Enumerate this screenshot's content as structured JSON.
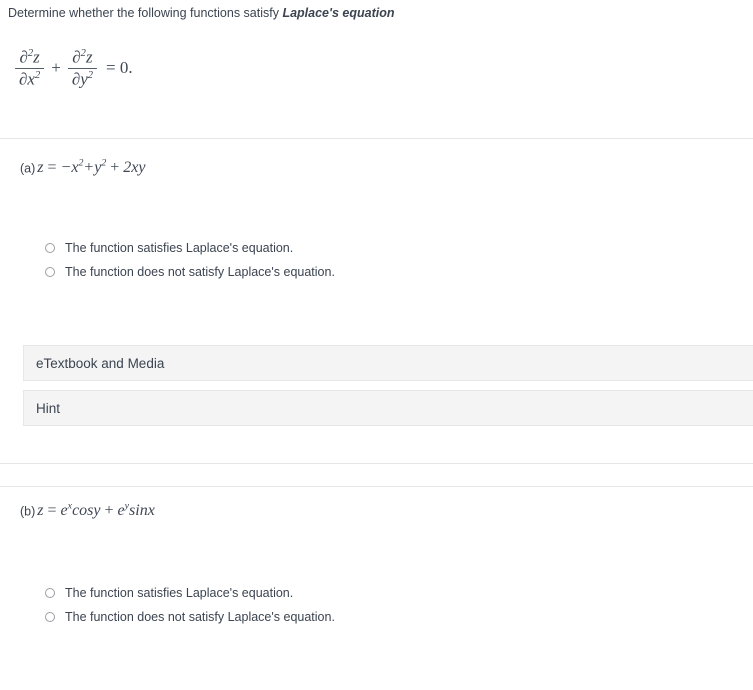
{
  "prompt": {
    "lead": "Determine whether the following functions satisfy ",
    "emphasis": "Laplace's equation"
  },
  "laplace_equation": {
    "numerator_1": "∂",
    "numerator_1_sup": "2",
    "numerator_1_var": "z",
    "denominator_1": "∂",
    "denominator_1_var": "x",
    "denominator_1_sup": "2",
    "operator": "+",
    "numerator_2": "∂",
    "numerator_2_sup": "2",
    "numerator_2_var": "z",
    "denominator_2": "∂",
    "denominator_2_var": "y",
    "denominator_2_sup": "2",
    "equals_zero": "= 0.",
    "plain_text": "∂²z/∂x² + ∂²z/∂y² = 0."
  },
  "parts": [
    {
      "tag": "(a)",
      "equation_plain": "z = −x² + y² + 2xy",
      "options": [
        {
          "label": "The function satisfies Laplace's equation.",
          "selected": false
        },
        {
          "label": "The function does not satisfy Laplace's equation.",
          "selected": false
        }
      ],
      "panels": [
        {
          "label": "eTextbook and Media"
        },
        {
          "label": "Hint"
        }
      ]
    },
    {
      "tag": "(b)",
      "equation_plain": "z = eˣ cos y + eʸ sin x",
      "options": [
        {
          "label": "The function satisfies Laplace's equation.",
          "selected": false
        },
        {
          "label": "The function does not satisfy Laplace's equation.",
          "selected": false
        }
      ],
      "panels": []
    }
  ],
  "colors": {
    "text": "#3b4450",
    "math_text": "#3f4753",
    "panel_background": "#f4f4f5",
    "panel_border": "#e6e7e9",
    "divider": "#e4e6e8",
    "radio_border": "#9aa0a6",
    "page_background": "#ffffff"
  }
}
